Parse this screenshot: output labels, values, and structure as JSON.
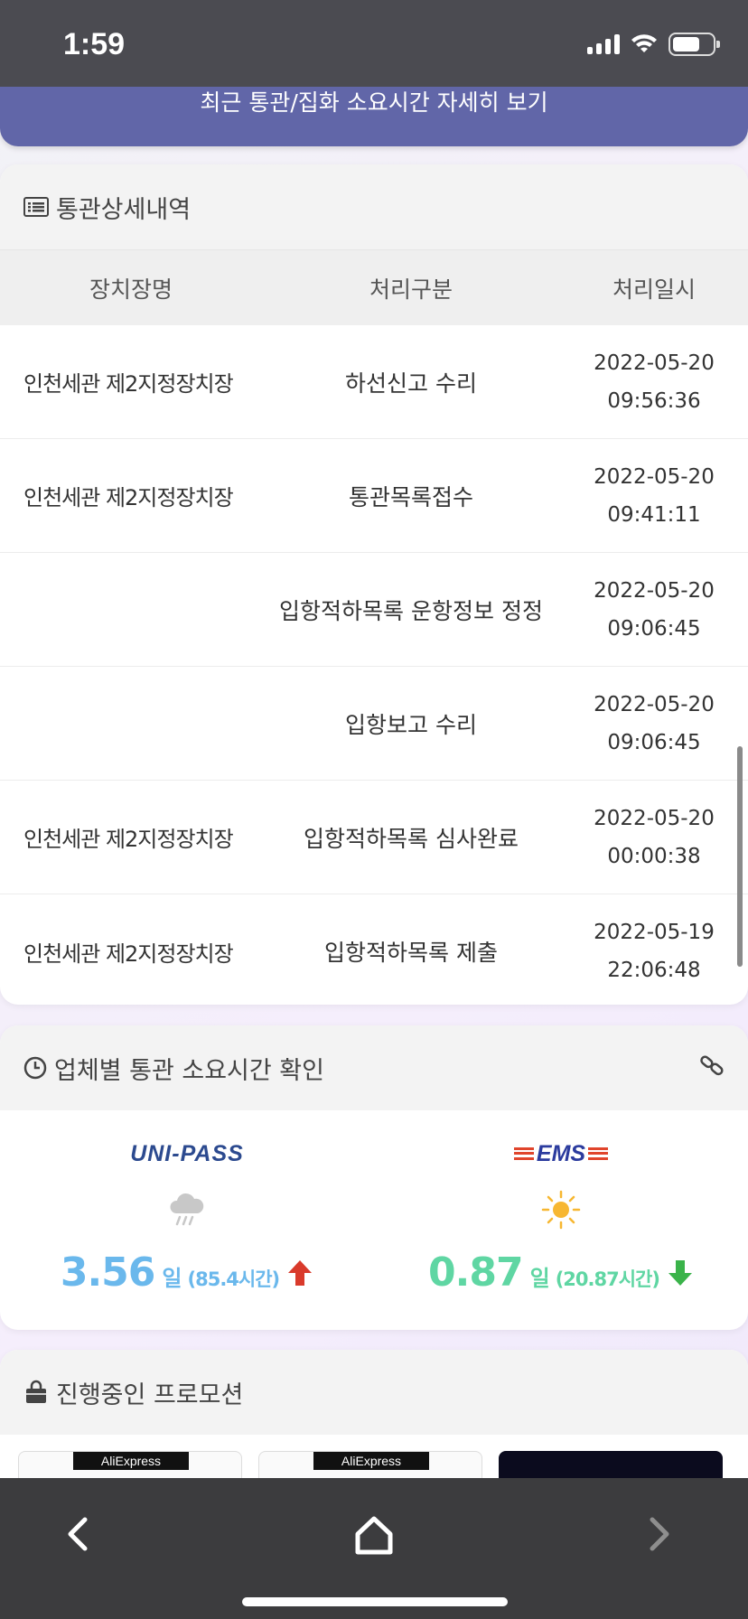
{
  "status": {
    "time": "1:59"
  },
  "banner": {
    "label": "최근 통관/집화 소요시간 자세히 보기"
  },
  "detail": {
    "title": "통관상세내역",
    "columns": [
      "장치장명",
      "처리구분",
      "처리일시"
    ],
    "rows": [
      {
        "location": "인천세관 제2지정장치장",
        "type": "하선신고 수리",
        "date": "2022-05-20",
        "time": "09:56:36"
      },
      {
        "location": "인천세관 제2지정장치장",
        "type": "통관목록접수",
        "date": "2022-05-20",
        "time": "09:41:11"
      },
      {
        "location": "",
        "type": "입항적하목록 운항정보 정정",
        "date": "2022-05-20",
        "time": "09:06:45"
      },
      {
        "location": "",
        "type": "입항보고 수리",
        "date": "2022-05-20",
        "time": "09:06:45"
      },
      {
        "location": "인천세관 제2지정장치장",
        "type": "입항적하목록 심사완료",
        "date": "2022-05-20",
        "time": "00:00:38"
      },
      {
        "location": "인천세관 제2지정장치장",
        "type": "입항적하목록 제출",
        "date": "2022-05-19",
        "time": "22:06:48"
      }
    ]
  },
  "timecheck": {
    "title": "업체별 통관 소요시간 확인",
    "vendors": [
      {
        "logo": "UNI-PASS",
        "weather_icon": "rain-cloud-icon",
        "days": "3.56",
        "unit": "일",
        "hours": "(85.4시간)",
        "trend": "up",
        "color": "#6ab8ec",
        "arrow_color": "#d93a2b"
      },
      {
        "logo": "EMS",
        "weather_icon": "sun-icon",
        "days": "0.87",
        "unit": "일",
        "hours": "(20.87시간)",
        "trend": "down",
        "color": "#5fd6a3",
        "arrow_color": "#3ab34a"
      }
    ]
  },
  "promo": {
    "title": "진행중인 프로모션",
    "items": [
      {
        "tag": "AliExpress"
      },
      {
        "tag": "AliExpress"
      },
      {
        "tag": ""
      }
    ]
  }
}
